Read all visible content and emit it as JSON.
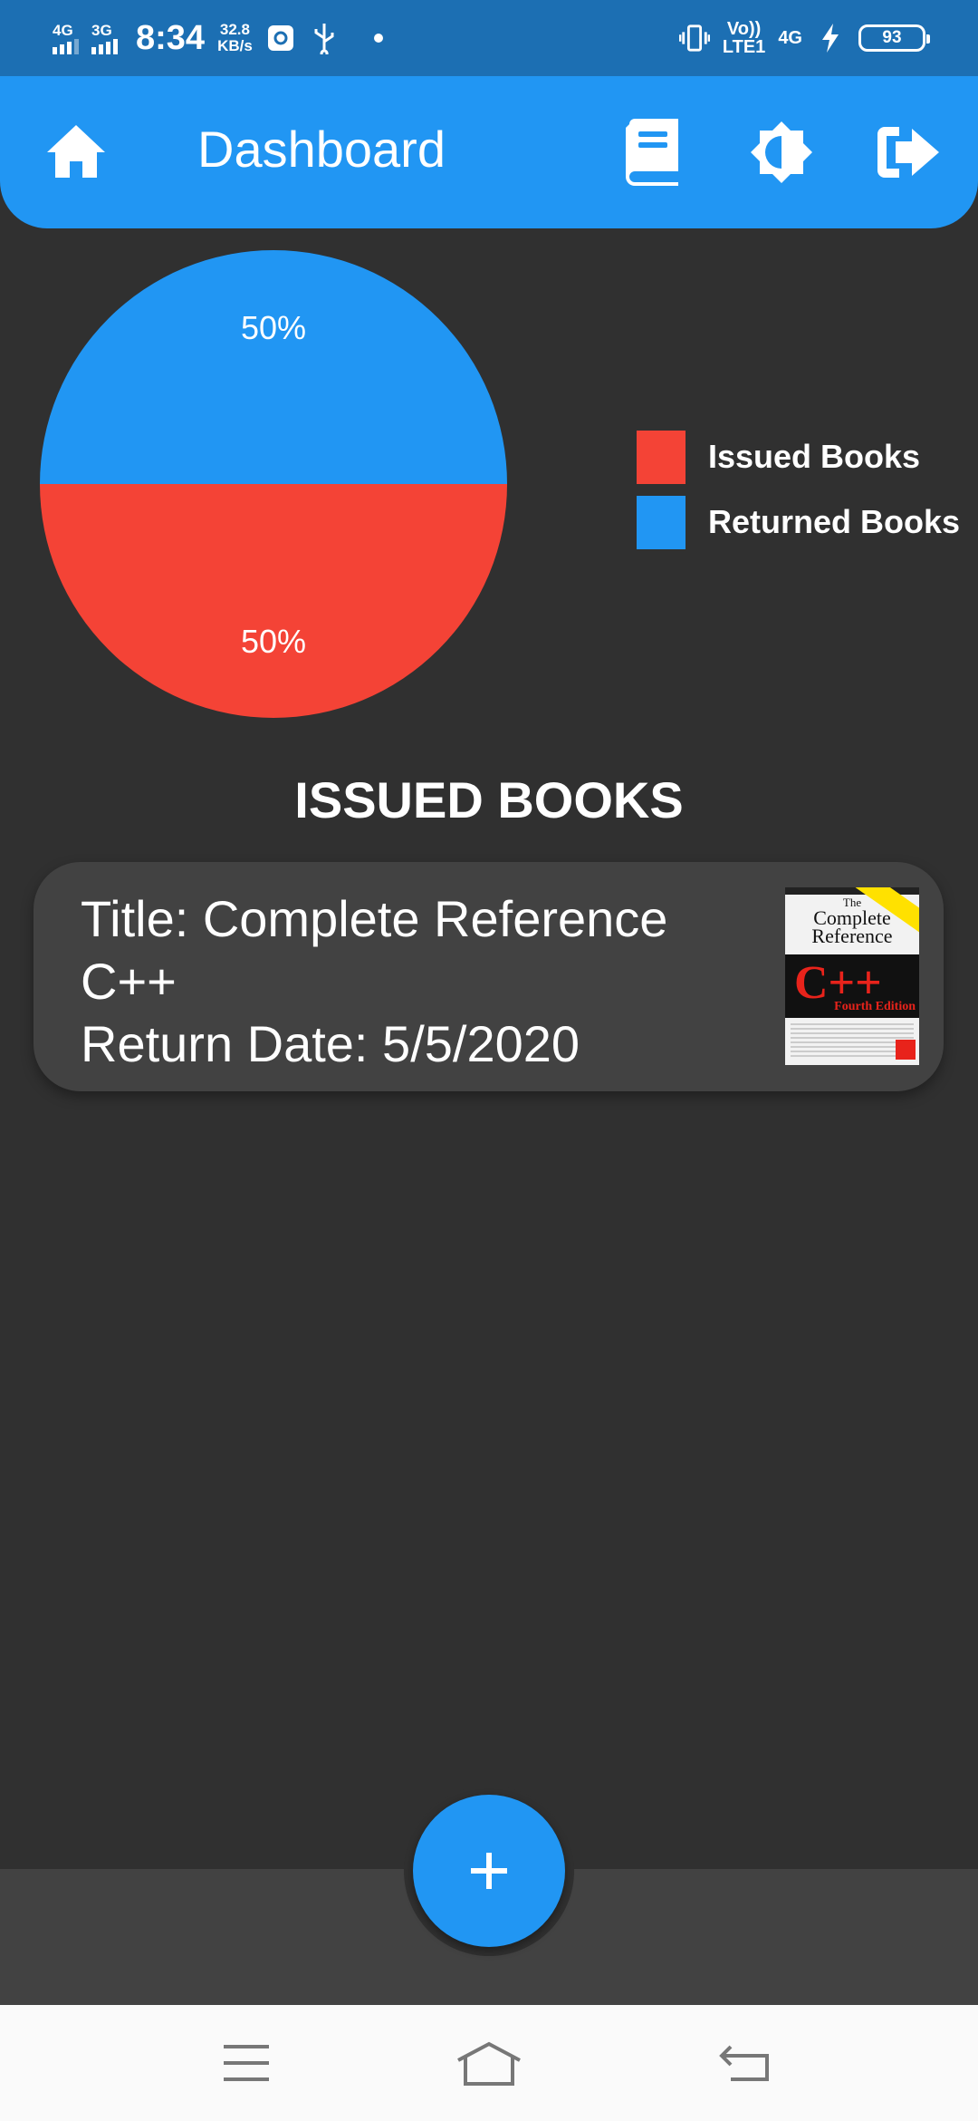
{
  "status_bar": {
    "net1": "4G",
    "net2": "3G",
    "time": "8:34",
    "speed_value": "32.8",
    "speed_unit": "KB/s",
    "volte_top": "Vo))",
    "volte_bottom": "LTE1",
    "net3": "4G",
    "battery": "93"
  },
  "app_bar": {
    "title": "Dashboard",
    "home_icon": "home-icon",
    "actions": [
      "book-icon",
      "brightness-icon",
      "logout-icon"
    ],
    "color": "#2196f3"
  },
  "chart_data": {
    "type": "pie",
    "labels": [
      "Issued Books",
      "Returned Books"
    ],
    "values": [
      50,
      50
    ],
    "slice_labels": [
      "50%",
      "50%"
    ],
    "colors": [
      "#f44336",
      "#2196f3"
    ],
    "legend_position": "right"
  },
  "section": {
    "title": "ISSUED BOOKS"
  },
  "issued_books": [
    {
      "title_line": "Title: Complete Reference C++",
      "return_line": "Return Date: 5/5/2020",
      "cover": {
        "line1": "The",
        "line2": "Complete",
        "line3": "Reference",
        "big": "C++",
        "edition": "Fourth Edition"
      }
    }
  ],
  "fab": {
    "icon": "plus-icon",
    "label": "+"
  },
  "nav_bar": {
    "buttons": [
      "menu-icon",
      "home-outline-icon",
      "back-icon"
    ]
  }
}
